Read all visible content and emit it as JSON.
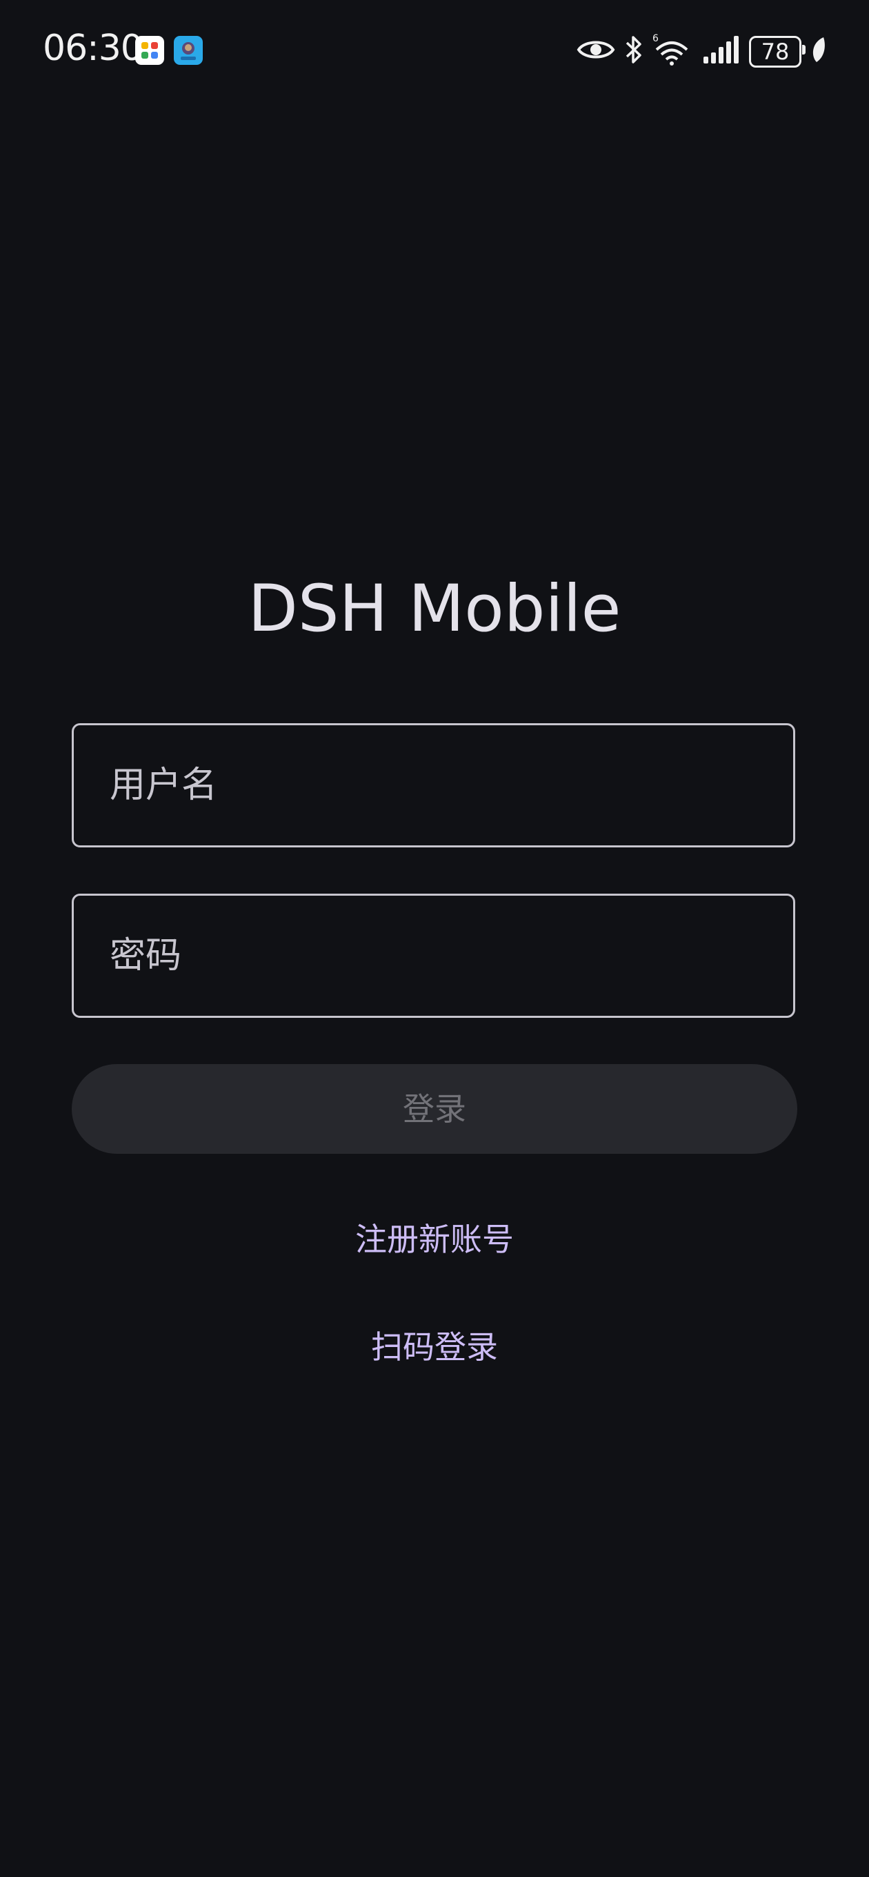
{
  "status_bar": {
    "time": "06:30",
    "battery_level": "78",
    "icons": [
      "app-grid-icon",
      "app-avatar-icon",
      "eye-icon",
      "bluetooth-icon",
      "wifi-6-icon",
      "cellular-signal-icon",
      "battery-icon",
      "leaf-icon"
    ]
  },
  "login": {
    "title": "DSH Mobile",
    "username_placeholder": "用户名",
    "password_placeholder": "密码",
    "login_label": "登录",
    "register_label": "注册新账号",
    "scan_label": "扫码登录"
  },
  "colors": {
    "background": "#101115",
    "field_border": "#c7c5ce",
    "button_bg": "#27282d",
    "button_text": "#727278",
    "link": "#cdbdf6"
  }
}
